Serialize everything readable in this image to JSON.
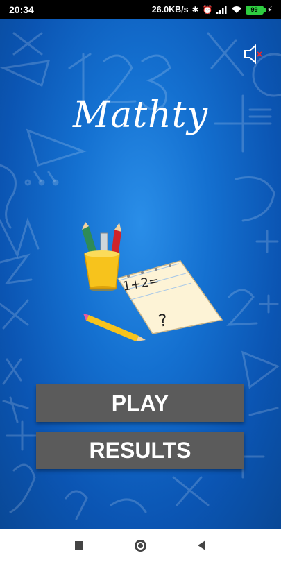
{
  "status_bar": {
    "time": "20:34",
    "network_speed": "26.0KB/s",
    "battery_level": "99",
    "icons": [
      "bluetooth-icon",
      "alarm-icon",
      "signal-icon",
      "wifi-icon",
      "battery-icon",
      "charging-icon"
    ]
  },
  "app": {
    "title": "Mathty",
    "sound_icon": "speaker-muted-icon",
    "illustration": {
      "equation": "1+2=",
      "question": "?"
    },
    "buttons": {
      "play": "PLAY",
      "results": "RESULTS"
    }
  },
  "nav_bar": {
    "icons": [
      "recent-apps-icon",
      "home-icon",
      "back-icon"
    ]
  },
  "colors": {
    "background_center": "#2a8ee8",
    "background_edge": "#094896",
    "button": "#5b5b5b",
    "battery": "#2ecc40"
  }
}
